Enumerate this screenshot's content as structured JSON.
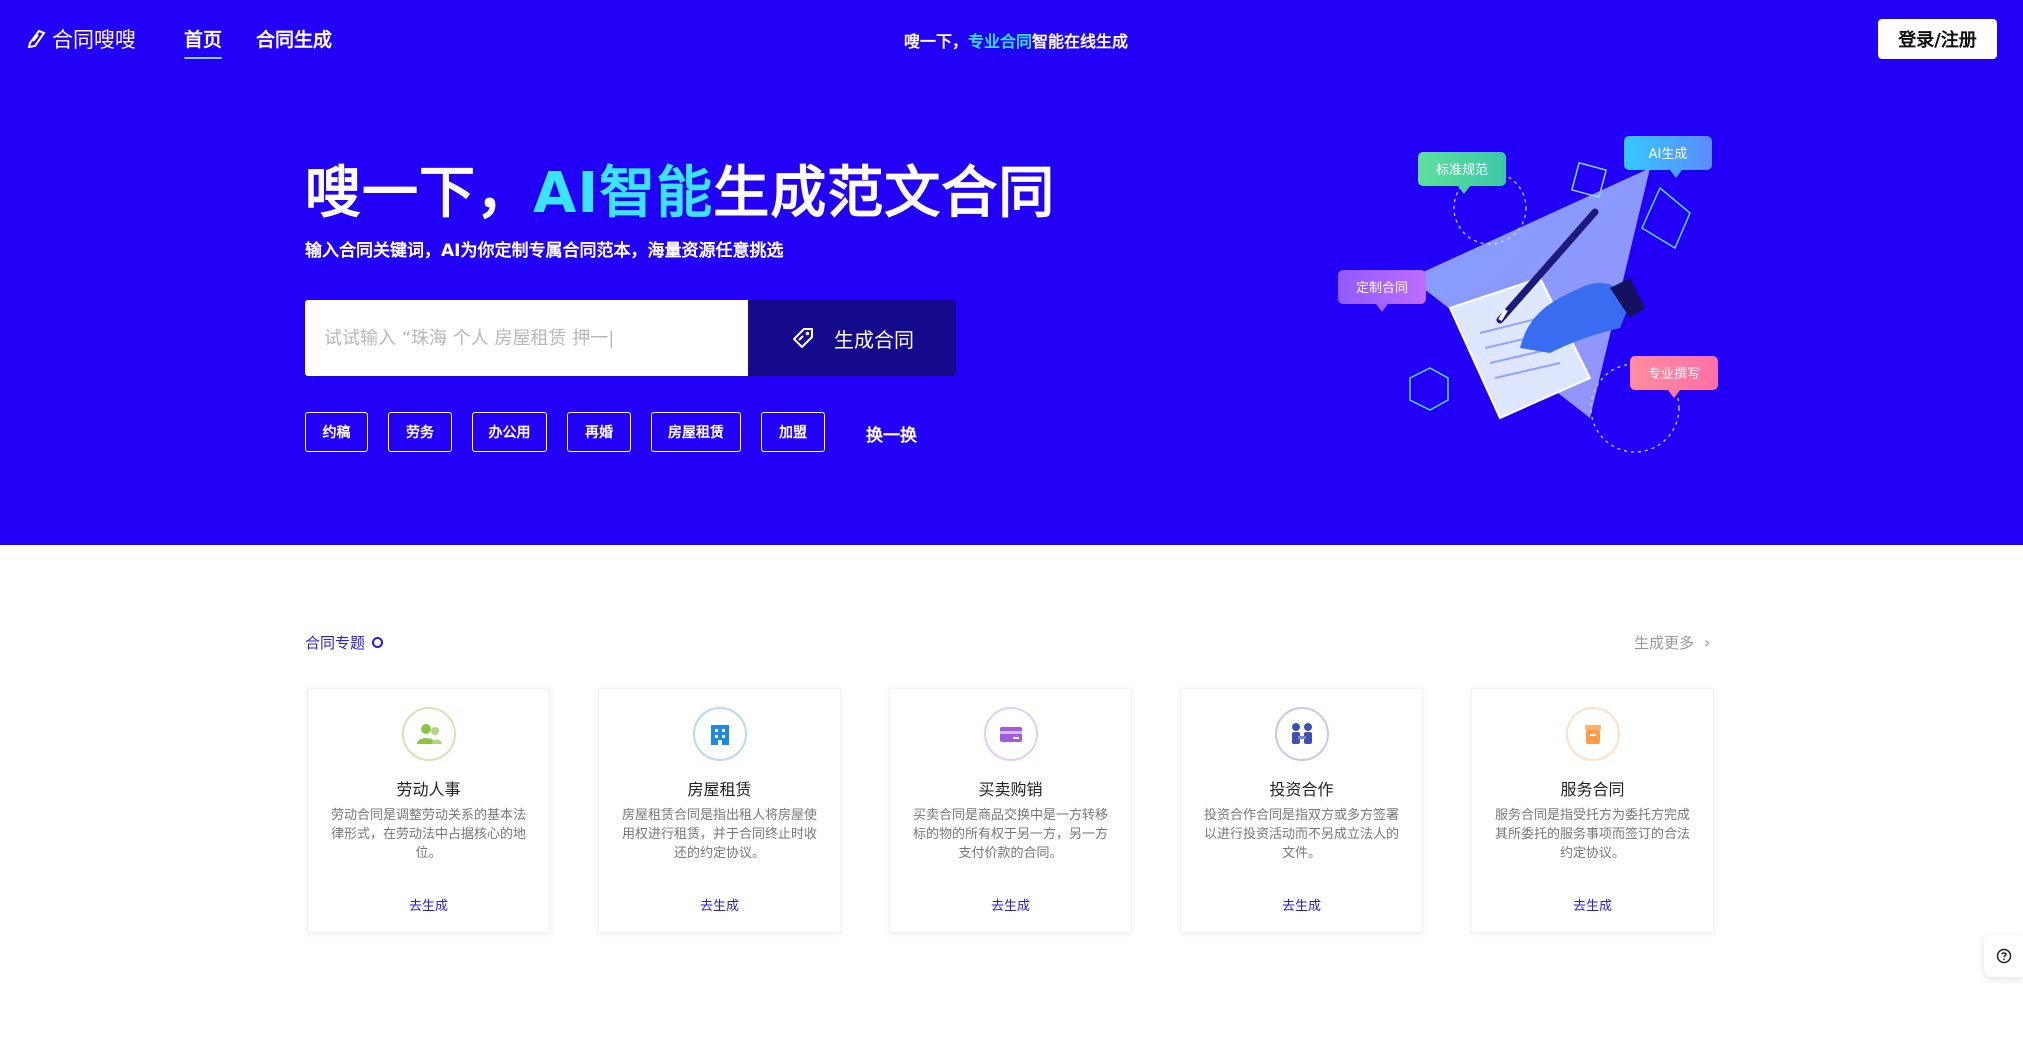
{
  "nav": {
    "logo_text": "合同嗖嗖",
    "links": [
      {
        "label": "首页"
      },
      {
        "label": "合同生成"
      }
    ],
    "slogan_prefix": "嗖一下，",
    "slogan_highlight": "专业合同",
    "slogan_suffix": "智能在线生成",
    "login_label": "登录/注册"
  },
  "hero": {
    "headline_prefix": "嗖一下，",
    "headline_highlight": "AI智能",
    "headline_suffix": "生成范文合同",
    "subline": "输入合同关键词，AI为你定制专属合同范本，海量资源任意挑选",
    "search_placeholder": "试试输入 “珠海 个人 房屋租赁 押一|",
    "generate_label": "生成合同",
    "tags": [
      "约稿",
      "劳务",
      "办公用",
      "再婚",
      "房屋租赁",
      "加盟"
    ],
    "refresh_label": "换一换",
    "bubbles": [
      "标准规范",
      "AI生成",
      "定制合同",
      "专业撰写"
    ]
  },
  "section": {
    "title": "合同专题",
    "more_label": "生成更多",
    "cards": [
      {
        "title": "劳动人事",
        "desc": "劳动合同是调整劳动关系的基本法律形式，在劳动法中占据核心的地位。",
        "action": "去生成",
        "icon": "people-icon",
        "color": "#8bc34a"
      },
      {
        "title": "房屋租赁",
        "desc": "房屋租赁合同是指出租人将房屋使用权进行租赁，并于合同终止时收还的约定协议。",
        "action": "去生成",
        "icon": "building-icon",
        "color": "#1e88e5"
      },
      {
        "title": "买卖购销",
        "desc": "买卖合同是商品交换中是一方转移标的物的所有权于另一方，另一方支付价款的合同。",
        "action": "去生成",
        "icon": "card-icon",
        "color": "#a05be0"
      },
      {
        "title": "投资合作",
        "desc": "投资合作合同是指双方或多方签署以进行投资活动而不另成立法人的文件。",
        "action": "去生成",
        "icon": "handshake-icon",
        "color": "#3f51b5"
      },
      {
        "title": "服务合同",
        "desc": "服务合同是指受托方为委托方完成其所委托的服务事项而签订的合法约定协议。",
        "action": "去生成",
        "icon": "box-icon",
        "color": "#ff9a4a"
      }
    ]
  },
  "colors": {
    "hero_bg": "#2200f5",
    "accent": "#35e0ff",
    "button_dark": "#150a8c",
    "link": "#2a1be0"
  }
}
